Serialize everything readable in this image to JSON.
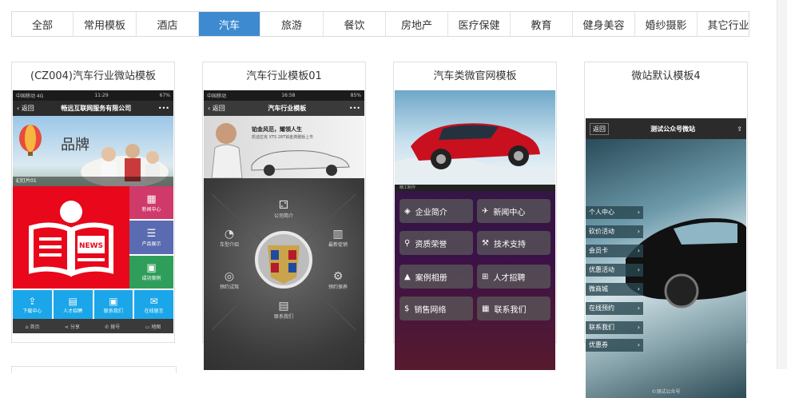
{
  "tabs": [
    {
      "label": "全部",
      "active": false
    },
    {
      "label": "常用模板",
      "active": false
    },
    {
      "label": "酒店",
      "active": false
    },
    {
      "label": "汽车",
      "active": true
    },
    {
      "label": "旅游",
      "active": false
    },
    {
      "label": "餐饮",
      "active": false
    },
    {
      "label": "房地产",
      "active": false
    },
    {
      "label": "医疗保健",
      "active": false
    },
    {
      "label": "教育",
      "active": false
    },
    {
      "label": "健身美容",
      "active": false
    },
    {
      "label": "婚纱摄影",
      "active": false
    },
    {
      "label": "其它行业",
      "active": false
    }
  ],
  "cards": [
    {
      "title": "(CZ004)汽车行业微站模板"
    },
    {
      "title": "汽车行业模板01"
    },
    {
      "title": "汽车类微官网模板"
    },
    {
      "title": "微站默认模板4"
    }
  ],
  "t1": {
    "status_left": "中国移动 4G",
    "status_time": "11:29",
    "status_right": "67%",
    "back": "返回",
    "header": "畅远互联网服务有限公司",
    "more": "•••",
    "brand_text": "品牌",
    "slide_caption": "幻灯片01",
    "news_badge": "NEWS",
    "cells": [
      "新闻中心",
      "产品展示",
      "成功案例"
    ],
    "bottom": [
      "下载中心",
      "人才招聘",
      "联系我们",
      "在线留言"
    ],
    "footer": [
      "首页",
      "分享",
      "拨号",
      "地图"
    ]
  },
  "t2": {
    "status_left": "中国移动",
    "status_time": "16:58",
    "status_right": "85%",
    "back": "返回",
    "header": "汽车行业模板",
    "more": "•••",
    "ad_line1": "铂金风范，耀领人生",
    "ad_line2": "凯迪拉克 XTS 28T铂金典雅版上市",
    "items": [
      "公司简介",
      "车型介绍",
      "最新促销",
      "预约试驾",
      "预约保养",
      "联系我们"
    ]
  },
  "t3": {
    "caption": "精工制作",
    "buttons": [
      "企业简介",
      "新闻中心",
      "资质荣誉",
      "技术支持",
      "案例相册",
      "人才招聘",
      "销售网络",
      "联系我们"
    ]
  },
  "t4": {
    "back": "返回",
    "header": "测试公众号微站",
    "menu": [
      "个人中心",
      "砍价活动",
      "会员卡",
      "优惠活动",
      "微商城",
      "在线预约",
      "联系我们",
      "优惠券"
    ],
    "footer": "©测试公众号"
  }
}
